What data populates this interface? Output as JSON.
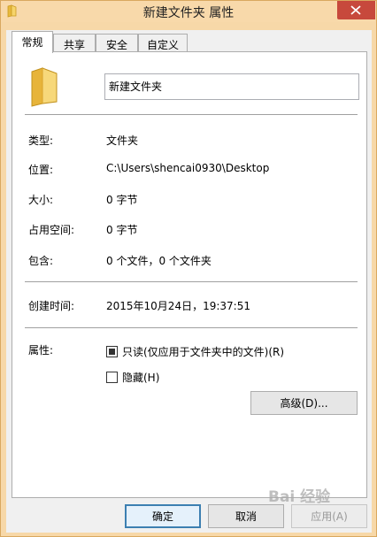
{
  "window": {
    "title": "新建文件夹 属性"
  },
  "tabs": [
    {
      "label": "常规",
      "active": true
    },
    {
      "label": "共享",
      "active": false
    },
    {
      "label": "安全",
      "active": false
    },
    {
      "label": "自定义",
      "active": false
    }
  ],
  "general": {
    "folder_name": "新建文件夹",
    "type": {
      "label": "类型:",
      "value": "文件夹"
    },
    "location": {
      "label": "位置:",
      "value": "C:\\Users\\shencai0930\\Desktop"
    },
    "size": {
      "label": "大小:",
      "value": "0 字节"
    },
    "size_on_disk": {
      "label": "占用空间:",
      "value": "0 字节"
    },
    "contains": {
      "label": "包含:",
      "value": "0 个文件，0 个文件夹"
    },
    "created": {
      "label": "创建时间:",
      "value": "2015年10月24日，19:37:51"
    },
    "attributes": {
      "label": "属性:",
      "readonly": {
        "label": "只读(仅应用于文件夹中的文件)(R)",
        "state": "indeterminate"
      },
      "hidden": {
        "label": "隐藏(H)",
        "state": "unchecked"
      },
      "advanced_label": "高级(D)..."
    }
  },
  "footer": {
    "ok_label": "确定",
    "cancel_label": "取消",
    "apply_label": "应用(A)"
  },
  "watermark": "Bai 经验",
  "colors": {
    "titlebar": "#f8d9aa",
    "close": "#c7493c",
    "default_button_border": "#3c7fb1"
  }
}
